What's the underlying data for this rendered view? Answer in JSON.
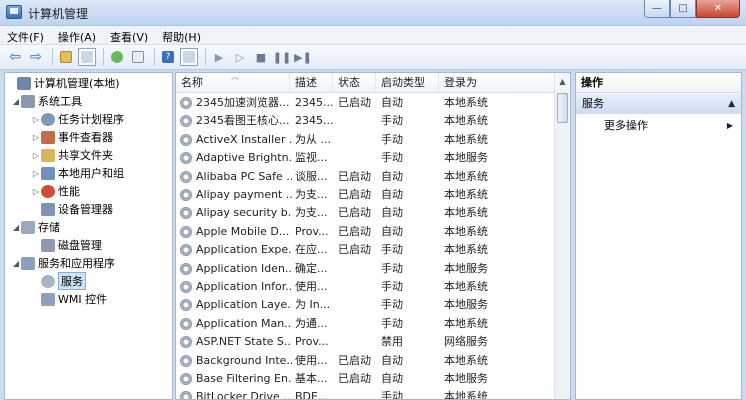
{
  "window": {
    "title": "计算机管理",
    "buttons": {
      "minimize": "—",
      "maximize": "□",
      "close": "✕"
    }
  },
  "menu": [
    "文件(F)",
    "操作(A)",
    "查看(V)",
    "帮助(H)"
  ],
  "tree": [
    {
      "label": "计算机管理(本地)",
      "color": "#6d87a8"
    },
    {
      "label": "系统工具",
      "color": "#8a98ad"
    },
    {
      "label": "任务计划程序",
      "color": "#7f9ab9"
    },
    {
      "label": "事件查看器",
      "color": "#c46a4a"
    },
    {
      "label": "共享文件夹",
      "color": "#d8b45a"
    },
    {
      "label": "本地用户和组",
      "color": "#6f8fbd"
    },
    {
      "label": "性能",
      "color": "#d24b3a"
    },
    {
      "label": "设备管理器",
      "color": "#7d93b3"
    },
    {
      "label": "存储",
      "color": "#9aa9bd"
    },
    {
      "label": "磁盘管理",
      "color": "#8c9bb0"
    },
    {
      "label": "服务和应用程序",
      "color": "#8aa0bd"
    },
    {
      "label": "服务",
      "color": "#a5b4c6"
    },
    {
      "label": "WMI 控件",
      "color": "#8ea2bf"
    }
  ],
  "columns": [
    "名称",
    "描述",
    "状态",
    "启动类型",
    "登录为"
  ],
  "services": [
    [
      "2345加速浏览器...",
      "2345...",
      "已启动",
      "自动",
      "本地系统"
    ],
    [
      "2345看图王核心...",
      "2345...",
      "",
      "手动",
      "本地系统"
    ],
    [
      "ActiveX Installer ...",
      "为从 ...",
      "",
      "手动",
      "本地系统"
    ],
    [
      "Adaptive Brightn...",
      "监视...",
      "",
      "手动",
      "本地服务"
    ],
    [
      "Alibaba PC Safe ...",
      "谈服...",
      "已启动",
      "自动",
      "本地系统"
    ],
    [
      "Alipay payment ...",
      "为支...",
      "已启动",
      "自动",
      "本地系统"
    ],
    [
      "Alipay security b...",
      "为支...",
      "已启动",
      "自动",
      "本地系统"
    ],
    [
      "Apple Mobile D...",
      "Prov...",
      "已启动",
      "自动",
      "本地系统"
    ],
    [
      "Application Expe...",
      "在应...",
      "已启动",
      "手动",
      "本地系统"
    ],
    [
      "Application Iden...",
      "确定...",
      "",
      "手动",
      "本地服务"
    ],
    [
      "Application Infor...",
      "使用...",
      "",
      "手动",
      "本地系统"
    ],
    [
      "Application Laye...",
      "为 In...",
      "",
      "手动",
      "本地服务"
    ],
    [
      "Application Man...",
      "为通...",
      "",
      "手动",
      "本地系统"
    ],
    [
      "ASP.NET State S...",
      "Prov...",
      "",
      "禁用",
      "网络服务"
    ],
    [
      "Background Inte...",
      "使用...",
      "已启动",
      "自动",
      "本地系统"
    ],
    [
      "Base Filtering En...",
      "基本...",
      "已启动",
      "自动",
      "本地服务"
    ],
    [
      "BitLocker Drive ...",
      "BDE...",
      "",
      "手动",
      "本地系统"
    ]
  ],
  "actions": {
    "header": "操作",
    "section": "服务",
    "item": "更多操作"
  }
}
